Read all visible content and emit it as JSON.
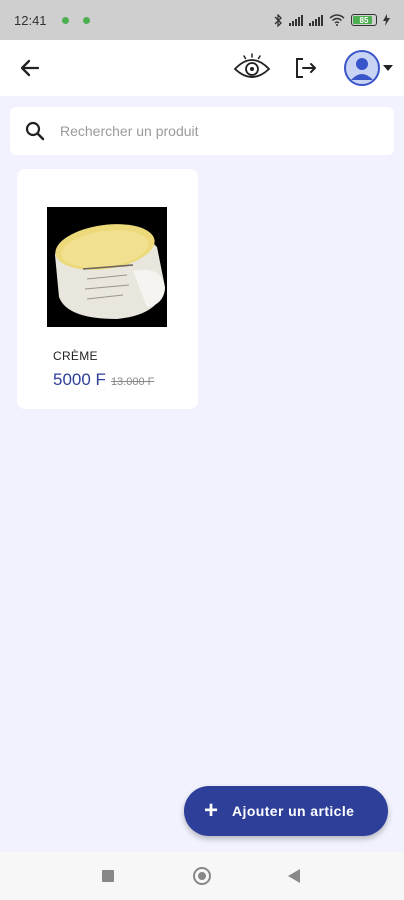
{
  "status_bar": {
    "time": "12:41",
    "battery": "85",
    "icons": [
      "bluetooth-icon",
      "signal-icon",
      "signal-icon",
      "wifi-icon",
      "battery-icon",
      "charging-icon"
    ]
  },
  "app_bar": {
    "icons": [
      "back-arrow-icon",
      "eye-icon",
      "logout-icon",
      "avatar-icon",
      "caret-down-icon"
    ]
  },
  "search": {
    "placeholder": "Rechercher un produit",
    "value": ""
  },
  "products": [
    {
      "name": "CRÈME",
      "price": "5000 F",
      "old_price": "13.000 F",
      "image_label": "Beurre de Karité"
    }
  ],
  "fab": {
    "plus": "+",
    "label": "Ajouter un article"
  },
  "colors": {
    "accent": "#2e3f9a",
    "background": "#f1f2fd",
    "status_bar": "#cfcfcf",
    "status_dot": "#4caf50"
  }
}
